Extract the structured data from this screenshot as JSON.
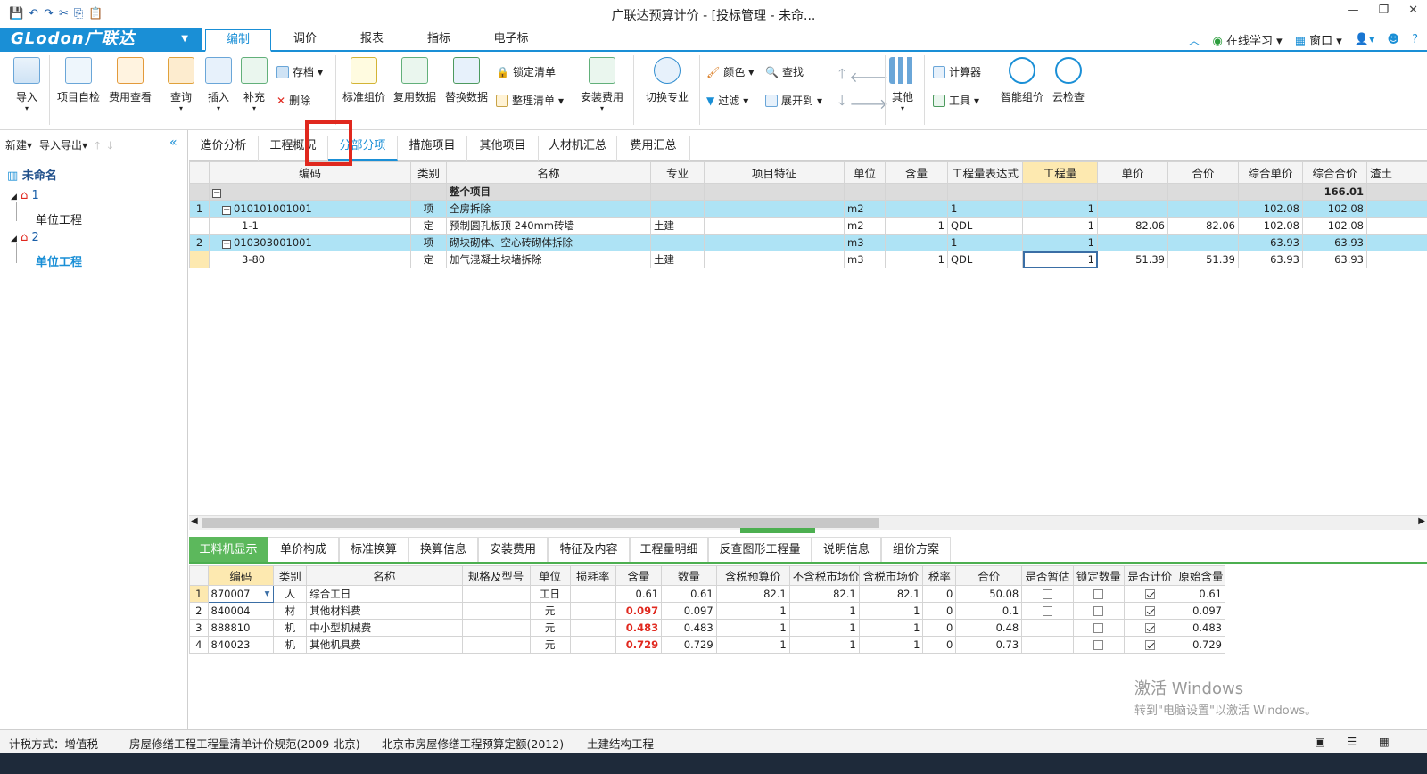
{
  "window": {
    "title": "广联达预算计价 - [投标管理 - 未命...",
    "controls": [
      "—",
      "❐",
      "✕"
    ]
  },
  "brand": {
    "logo": "GLodon广联达"
  },
  "menu": {
    "tabs": [
      "编制",
      "调价",
      "报表",
      "指标",
      "电子标"
    ],
    "right": {
      "online": "在线学习",
      "window": "窗口",
      "help": "?"
    }
  },
  "ribbon": {
    "import": "导入",
    "self_check": "项目自检",
    "fee_view": "费用查看",
    "query": "查询",
    "insert": "插入",
    "supplement": "补充",
    "archive": "存档",
    "delete": "删除",
    "std_price": "标准组价",
    "reuse": "复用数据",
    "replace": "替换数据",
    "lock_list": "锁定清单",
    "sort_list": "整理清单",
    "install_fee": "安装费用",
    "switch_major": "切换专业",
    "color": "颜色",
    "find": "查找",
    "filter": "过滤",
    "expand": "展开到",
    "other": "其他",
    "calculator": "计算器",
    "tools": "工具",
    "smart_price": "智能组价",
    "cloud_check": "云检查"
  },
  "left": {
    "new": "新建",
    "import_export": "导入导出",
    "root": "未命名",
    "nodes": [
      {
        "num": "1",
        "child": "单位工程"
      },
      {
        "num": "2",
        "child": "单位工程"
      }
    ]
  },
  "main_tabs": [
    "造价分析",
    "工程概况",
    "分部分项",
    "措施项目",
    "其他项目",
    "人材机汇总",
    "费用汇总"
  ],
  "grid": {
    "headers": [
      "编码",
      "类别",
      "名称",
      "专业",
      "项目特征",
      "单位",
      "含量",
      "工程量表达式",
      "工程量",
      "单价",
      "合价",
      "综合单价",
      "综合合价",
      "渣土"
    ],
    "summary": {
      "name": "整个项目",
      "total": "166.01"
    },
    "rows": [
      {
        "idx": "1",
        "code": "010101001001",
        "type": "项",
        "name": "全房拆除",
        "major": "",
        "unit": "m2",
        "content": "",
        "expr": "1",
        "qty": "1",
        "price": "",
        "amount": "",
        "cprice": "102.08",
        "camount": "102.08",
        "level": "item"
      },
      {
        "idx": "",
        "code": "1-1",
        "type": "定",
        "name": "预制圆孔板顶 240mm砖墙",
        "major": "土建",
        "unit": "m2",
        "content": "1",
        "expr": "QDL",
        "qty": "1",
        "price": "82.06",
        "amount": "82.06",
        "cprice": "102.08",
        "camount": "102.08",
        "level": "norm"
      },
      {
        "idx": "2",
        "code": "010303001001",
        "type": "项",
        "name": "砌块砌体、空心砖砌体拆除",
        "major": "",
        "unit": "m3",
        "content": "",
        "expr": "1",
        "qty": "1",
        "price": "",
        "amount": "",
        "cprice": "63.93",
        "camount": "63.93",
        "level": "item"
      },
      {
        "idx": "",
        "code": "3-80",
        "type": "定",
        "name": "加气混凝土块墙拆除",
        "major": "土建",
        "unit": "m3",
        "content": "1",
        "expr": "QDL",
        "qty": "1",
        "price": "51.39",
        "amount": "51.39",
        "cprice": "63.93",
        "camount": "63.93",
        "level": "norm"
      }
    ]
  },
  "bottom_tabs": [
    "工料机显示",
    "单价构成",
    "标准换算",
    "换算信息",
    "安装费用",
    "特征及内容",
    "工程量明细",
    "反查图形工程量",
    "说明信息",
    "组价方案"
  ],
  "subgrid": {
    "headers": [
      "编码",
      "类别",
      "名称",
      "规格及型号",
      "单位",
      "损耗率",
      "含量",
      "数量",
      "含税预算价",
      "不含税市场价",
      "含税市场价",
      "税率",
      "合价",
      "是否暂估",
      "锁定数量",
      "是否计价",
      "原始含量"
    ],
    "rows": [
      {
        "idx": "1",
        "code": "870007",
        "type": "人",
        "name": "综合工日",
        "unit": "工日",
        "content": "0.61",
        "qty": "0.61",
        "p1": "82.1",
        "p2": "82.1",
        "p3": "82.1",
        "tax": "0",
        "amount": "50.08",
        "est": false,
        "lock": false,
        "priced": true,
        "orig": "0.61",
        "red": false
      },
      {
        "idx": "2",
        "code": "840004",
        "type": "材",
        "name": "其他材料费",
        "unit": "元",
        "content": "0.097",
        "qty": "0.097",
        "p1": "1",
        "p2": "1",
        "p3": "1",
        "tax": "0",
        "amount": "0.1",
        "est": false,
        "lock": false,
        "priced": true,
        "orig": "0.097",
        "red": true
      },
      {
        "idx": "3",
        "code": "888810",
        "type": "机",
        "name": "中小型机械费",
        "unit": "元",
        "content": "0.483",
        "qty": "0.483",
        "p1": "1",
        "p2": "1",
        "p3": "1",
        "tax": "0",
        "amount": "0.48",
        "est": null,
        "lock": false,
        "priced": true,
        "orig": "0.483",
        "red": true
      },
      {
        "idx": "4",
        "code": "840023",
        "type": "机",
        "name": "其他机具费",
        "unit": "元",
        "content": "0.729",
        "qty": "0.729",
        "p1": "1",
        "p2": "1",
        "p3": "1",
        "tax": "0",
        "amount": "0.73",
        "est": null,
        "lock": false,
        "priced": true,
        "orig": "0.729",
        "red": true
      }
    ]
  },
  "status": {
    "tax_mode": "计税方式：增值税",
    "spec": "房屋修缮工程工程量清单计价规范(2009-北京)",
    "quota": "北京市房屋修缮工程预算定额(2012)",
    "major": "土建结构工程"
  },
  "watermark": {
    "line1": "激活 Windows",
    "line2": "转到\"电脑设置\"以激活 Windows。"
  },
  "colors": {
    "accent": "#1a8fd6",
    "item_row": "#aee3f5",
    "green_tab": "#5cb85c",
    "highlight_red": "#e0281e"
  }
}
